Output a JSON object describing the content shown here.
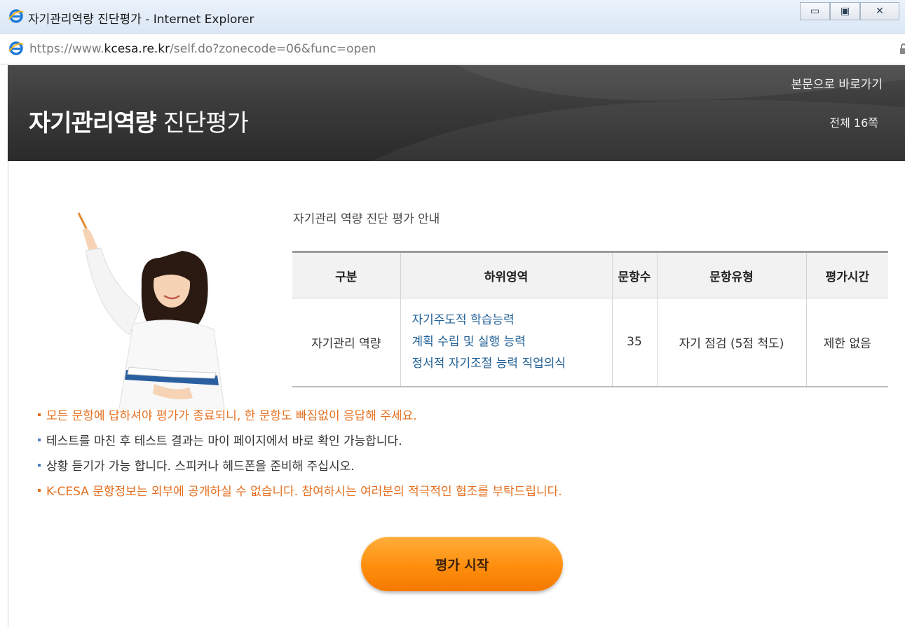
{
  "window": {
    "title": "자기관리역량 진단평가 - Internet Explorer",
    "controls": {
      "minimize": "▭",
      "maximize": "▣",
      "close": "✕"
    }
  },
  "address": {
    "url_prefix": "https://www.",
    "url_host": "kcesa.re.kr",
    "url_rest": "/self.do?zonecode=06&func=open"
  },
  "header": {
    "title_strong": "자기관리역량",
    "title_light": "진단평가",
    "skip_link": "본문으로 바로가기",
    "page_count": "전체 16쪽"
  },
  "guide": {
    "title": "자기관리 역량 진단 평가 안내",
    "table": {
      "headers": [
        "구분",
        "하위영역",
        "문항수",
        "문항유형",
        "평가시간"
      ],
      "row": {
        "category": "자기관리 역량",
        "areas": [
          "자기주도적 학습능력",
          "계획 수립 및 실행 능력",
          "정서적 자기조절 능력 직업의식"
        ],
        "count": "35",
        "type": "자기 점검 (5점 척도)",
        "time": "제한 없음"
      }
    }
  },
  "notices": [
    {
      "text": "모든 문항에 답하셔야 평가가 종료되니, 한 문항도 빠짐없이 응답해 주세요.",
      "color": "#e56f1f"
    },
    {
      "text": "테스트를 마친 후 테스트 결과는 마이 페이지에서 바로 확인 가능합니다.",
      "color": "#333333"
    },
    {
      "text": "상황 듣기가 가능 합니다. 스피커나 헤드폰을 준비해 주십시오.",
      "color": "#333333"
    },
    {
      "text": "K-CESA 문항정보는 외부에 공개하실 수 없습니다. 참여하시는 여러분의 적극적인 협조를 부탁드립니다.",
      "color": "#e56f1f"
    }
  ],
  "start_button": {
    "label": "평가 시작",
    "color": "#ff8e0d"
  },
  "icons": {
    "browser": "ie-icon",
    "lock": "lock-icon",
    "illustration": "student-with-book-and-pencil"
  }
}
